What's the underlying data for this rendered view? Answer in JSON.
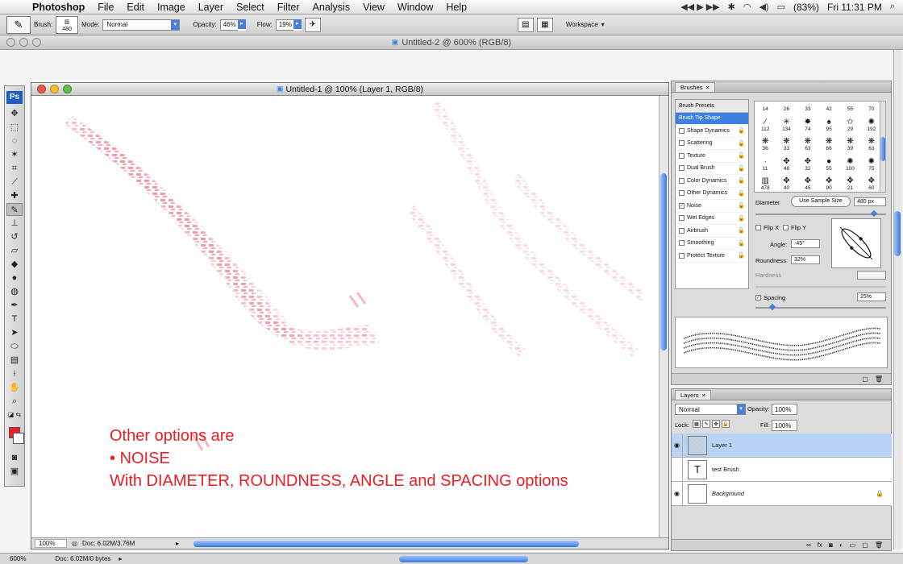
{
  "menubar": {
    "app_name": "Photoshop",
    "menus": [
      "File",
      "Edit",
      "Image",
      "Layer",
      "Select",
      "Filter",
      "Analysis",
      "View",
      "Window",
      "Help"
    ],
    "battery": "(83%)",
    "clock": "Fri 11:31 PM"
  },
  "options": {
    "brush_label": "Brush:",
    "brush_size": "480",
    "mode_label": "Mode:",
    "mode_value": "Normal",
    "opacity_label": "Opacity:",
    "opacity_value": "46%",
    "flow_label": "Flow:",
    "flow_value": "19%",
    "workspace_label": "Workspace"
  },
  "back_document": {
    "title": "Untitled-2 @ 600% (RGB/8)",
    "zoom": "600%",
    "doc_info": "Doc: 6.02M/0 bytes"
  },
  "document": {
    "title": "Untitled-1 @ 100% (Layer 1, RGB/8)",
    "zoom": "100%",
    "doc_info": "Doc: 6.02M/3.76M",
    "overlay_lines": [
      "Other options are",
      "• NOISE",
      "With DIAMETER, ROUNDNESS, ANGLE and SPACING options"
    ]
  },
  "brushes_panel": {
    "tab": "Brushes",
    "list": [
      {
        "label": "Brush Presets",
        "type": "header"
      },
      {
        "label": "Brush Tip Shape",
        "type": "selected"
      },
      {
        "label": "Shape Dynamics",
        "checked": false
      },
      {
        "label": "Scattering",
        "checked": false
      },
      {
        "label": "Texture",
        "checked": false
      },
      {
        "label": "Dual Brush",
        "checked": false
      },
      {
        "label": "Color Dynamics",
        "checked": false
      },
      {
        "label": "Other Dynamics",
        "checked": false
      },
      {
        "label": "Noise",
        "checked": true
      },
      {
        "label": "Wet Edges",
        "checked": false
      },
      {
        "label": "Airbrush",
        "checked": false
      },
      {
        "label": "Smoothing",
        "checked": false
      },
      {
        "label": "Protect Texture",
        "checked": false
      }
    ],
    "tip_sizes": [
      "14",
      "26",
      "33",
      "42",
      "55",
      "70",
      "112",
      "134",
      "74",
      "95",
      "29",
      "192",
      "36",
      "33",
      "63",
      "66",
      "39",
      "63",
      "11",
      "48",
      "32",
      "55",
      "100",
      "75",
      "478",
      "40",
      "45",
      "90",
      "21",
      "60"
    ],
    "diameter_label": "Diameter",
    "use_sample_label": "Use Sample Size",
    "diameter_value": "480 px",
    "flip_x_label": "Flip X",
    "flip_y_label": "Flip Y",
    "angle_label": "Angle:",
    "angle_value": "-45°",
    "roundness_label": "Roundness:",
    "roundness_value": "32%",
    "hardness_label": "Hardness",
    "spacing_label": "Spacing",
    "spacing_value": "25%"
  },
  "layers_panel": {
    "tab": "Layers",
    "blend_mode": "Normal",
    "opacity_label": "Opacity:",
    "opacity_value": "100%",
    "lock_label": "Lock:",
    "fill_label": "Fill:",
    "fill_value": "100%",
    "layers": [
      {
        "name": "Layer 1",
        "active": true
      },
      {
        "name": "test Brush",
        "active": false
      },
      {
        "name": "Background",
        "active": false
      }
    ]
  },
  "colors": {
    "accent": "#3d80df",
    "foreground": "#ee1c24",
    "stroke_pink": "#f7a8b0"
  }
}
